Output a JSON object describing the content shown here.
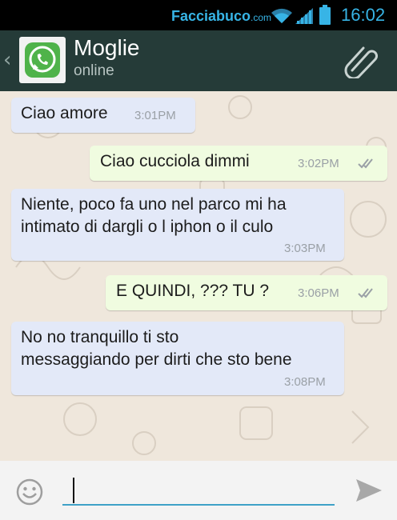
{
  "statusbar": {
    "watermark_main": "Facciabuco",
    "watermark_tld": ".com",
    "time": "16:02",
    "icons": [
      "wifi-icon",
      "signal-icon",
      "battery-icon"
    ],
    "accent_color": "#37b4e6"
  },
  "header": {
    "contact_name": "Moglie",
    "status": "online",
    "icons": [
      "back-chevron-icon",
      "whatsapp-logo-icon",
      "paperclip-icon"
    ],
    "background_color": "#253b38"
  },
  "messages": [
    {
      "direction": "incoming",
      "text": "Ciao amore",
      "time": "3:01PM"
    },
    {
      "direction": "outgoing",
      "text": "Ciao cucciola dimmi",
      "time": "3:02PM",
      "read": true
    },
    {
      "direction": "incoming",
      "text_lines": [
        "Niente, poco fa uno nel parco mi ha",
        "intimato di dargli o l iphon o il culo"
      ],
      "time": "3:03PM"
    },
    {
      "direction": "outgoing",
      "text": "E QUINDI, ??? TU ?",
      "time": "3:06PM",
      "read": true
    },
    {
      "direction": "incoming",
      "text_lines": [
        "No no tranquillo ti sto",
        "messaggiando per dirti che sto bene"
      ],
      "time": "3:08PM"
    }
  ],
  "composer": {
    "placeholder": "",
    "value": "",
    "icons": [
      "emoji-icon",
      "send-icon"
    ],
    "underline_color": "#3fa1c7"
  }
}
